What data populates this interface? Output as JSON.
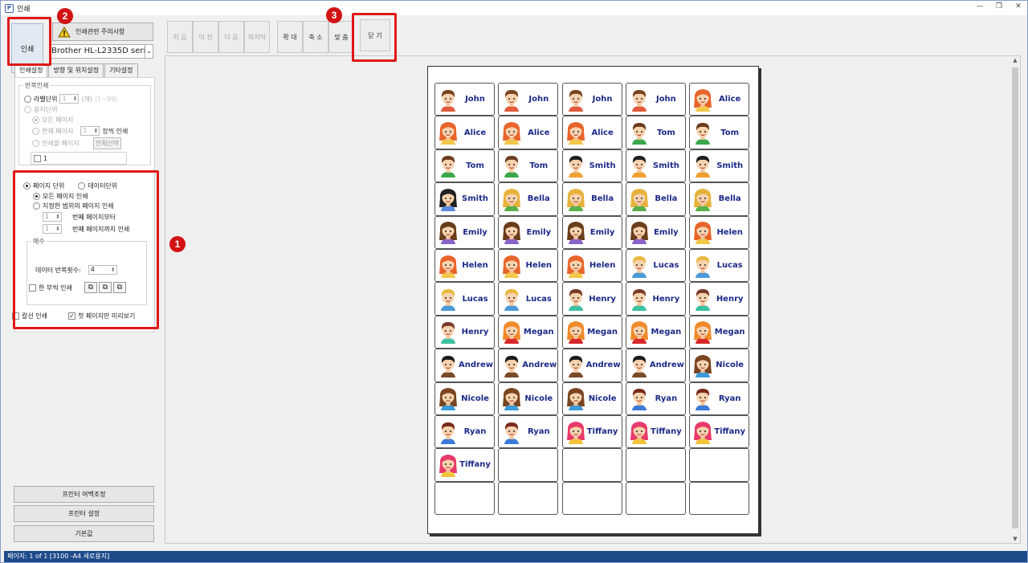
{
  "window": {
    "title": "인쇄",
    "app_icon": "print-app-icon"
  },
  "left": {
    "print_label": "인쇄",
    "notice_label": "인쇄관련 주의사항",
    "printer": "Brother HL-L2335D series(",
    "tabs": [
      "인쇄설정",
      "방향 및 위치설정",
      "기타설정"
    ],
    "repeat": {
      "title": "반복인쇄",
      "label_unit": "라벨단위",
      "label_count": "1",
      "label_count_unit": "(개)",
      "label_count_hint": "(1~99)",
      "sheet_unit": "용지단위",
      "all_pages": "모든 페이지",
      "current_page": "현재 페이지",
      "current_count": "1",
      "sheet_print": "장씩 인쇄",
      "print_pages": "인쇄할 페이지",
      "select_all": "전체선택",
      "page_item": "1"
    },
    "range": {
      "page_unit": "페이지 단위",
      "data_unit": "데이터단위",
      "all_print": "모든 페이지 인쇄",
      "range_print": "지정한 범위의 페이지 인쇄",
      "from_value": "1",
      "from_label": "번째 페이지부터",
      "to_value": "1",
      "to_label": "번째 페이지까지 인쇄"
    },
    "copies": {
      "title": "매수",
      "repeat_label": "데이터 반복횟수:",
      "repeat_value": "4",
      "one_copy": "한 부씩 인쇄"
    },
    "cutline": "칼선 인쇄",
    "first_preview": "첫 페이지만 미리보기",
    "buttons": [
      "프린터 여백조정",
      "프린터 설정",
      "기본값"
    ]
  },
  "badges": [
    "1",
    "2",
    "3"
  ],
  "toolbar": {
    "nav": [
      "처 음",
      "이 전",
      "다 음",
      "마지막"
    ],
    "zoom": [
      "확 대",
      "축 소",
      "맞 춤"
    ],
    "close": "닫 기"
  },
  "labels": [
    {
      "name": "John",
      "face": "boy-brown"
    },
    {
      "name": "John",
      "face": "boy-brown"
    },
    {
      "name": "John",
      "face": "boy-brown"
    },
    {
      "name": "John",
      "face": "boy-brown"
    },
    {
      "name": "Alice",
      "face": "girl-orange"
    },
    {
      "name": "Alice",
      "face": "girl-orange"
    },
    {
      "name": "Alice",
      "face": "girl-orange"
    },
    {
      "name": "Alice",
      "face": "girl-orange"
    },
    {
      "name": "Tom",
      "face": "boy-curly"
    },
    {
      "name": "Tom",
      "face": "boy-curly"
    },
    {
      "name": "Tom",
      "face": "boy-curly"
    },
    {
      "name": "Tom",
      "face": "boy-curly"
    },
    {
      "name": "Smith",
      "face": "boy-black"
    },
    {
      "name": "Smith",
      "face": "boy-black"
    },
    {
      "name": "Smith",
      "face": "boy-black"
    },
    {
      "name": "Smith",
      "face": "girl-black"
    },
    {
      "name": "Bella",
      "face": "girl-blonde"
    },
    {
      "name": "Bella",
      "face": "girl-blonde"
    },
    {
      "name": "Bella",
      "face": "girl-blonde"
    },
    {
      "name": "Bella",
      "face": "girl-blonde"
    },
    {
      "name": "Emily",
      "face": "girl-brown"
    },
    {
      "name": "Emily",
      "face": "girl-brown"
    },
    {
      "name": "Emily",
      "face": "girl-brown"
    },
    {
      "name": "Emily",
      "face": "girl-brown"
    },
    {
      "name": "Helen",
      "face": "girl-orange"
    },
    {
      "name": "Helen",
      "face": "girl-orange"
    },
    {
      "name": "Helen",
      "face": "girl-orange"
    },
    {
      "name": "Helen",
      "face": "girl-orange"
    },
    {
      "name": "Lucas",
      "face": "boy-blonde"
    },
    {
      "name": "Lucas",
      "face": "boy-blonde"
    },
    {
      "name": "Lucas",
      "face": "boy-blonde"
    },
    {
      "name": "Lucas",
      "face": "boy-blonde"
    },
    {
      "name": "Henry",
      "face": "boy-teal"
    },
    {
      "name": "Henry",
      "face": "boy-teal"
    },
    {
      "name": "Henry",
      "face": "boy-teal"
    },
    {
      "name": "Henry",
      "face": "boy-teal"
    },
    {
      "name": "Megan",
      "face": "girl-red"
    },
    {
      "name": "Megan",
      "face": "girl-red"
    },
    {
      "name": "Megan",
      "face": "girl-red"
    },
    {
      "name": "Megan",
      "face": "girl-red"
    },
    {
      "name": "Andrew",
      "face": "boy-dark"
    },
    {
      "name": "Andrew",
      "face": "boy-dark"
    },
    {
      "name": "Andrew",
      "face": "boy-dark"
    },
    {
      "name": "Andrew",
      "face": "boy-dark"
    },
    {
      "name": "Nicole",
      "face": "girl-headband"
    },
    {
      "name": "Nicole",
      "face": "girl-headband"
    },
    {
      "name": "Nicole",
      "face": "girl-headband"
    },
    {
      "name": "Nicole",
      "face": "girl-headband"
    },
    {
      "name": "Ryan",
      "face": "boy-red"
    },
    {
      "name": "Ryan",
      "face": "boy-red"
    },
    {
      "name": "Ryan",
      "face": "boy-red"
    },
    {
      "name": "Ryan",
      "face": "boy-red"
    },
    {
      "name": "Tiffany",
      "face": "girl-pink"
    },
    {
      "name": "Tiffany",
      "face": "girl-pink"
    },
    {
      "name": "Tiffany",
      "face": "girl-pink"
    },
    {
      "name": "Tiffany",
      "face": "girl-pink"
    },
    {
      "name": "",
      "face": ""
    },
    {
      "name": "",
      "face": ""
    },
    {
      "name": "",
      "face": ""
    },
    {
      "name": "",
      "face": ""
    },
    {
      "name": "",
      "face": ""
    },
    {
      "name": "",
      "face": ""
    },
    {
      "name": "",
      "face": ""
    },
    {
      "name": "",
      "face": ""
    },
    {
      "name": "",
      "face": ""
    }
  ],
  "face_colors": {
    "boy-brown": {
      "hair": "#7a4520",
      "shirt": "#e05a3c"
    },
    "girl-orange": {
      "hair": "#e8642a",
      "shirt": "#f3c74a"
    },
    "boy-curly": {
      "hair": "#6b3d1e",
      "shirt": "#3aa84a"
    },
    "boy-black": {
      "hair": "#1e1e1e",
      "shirt": "#f0a030"
    },
    "girl-black": {
      "hair": "#222222",
      "shirt": "#5b8de0"
    },
    "girl-blonde": {
      "hair": "#e6b23a",
      "shirt": "#5ab04a"
    },
    "girl-brown": {
      "hair": "#6a3d1c",
      "shirt": "#8a62c8"
    },
    "boy-blonde": {
      "hair": "#e8b840",
      "shirt": "#4a9ad8"
    },
    "boy-teal": {
      "hair": "#7a3a28",
      "shirt": "#3cc0a0"
    },
    "girl-red": {
      "hair": "#f08a2a",
      "shirt": "#d8282a"
    },
    "boy-dark": {
      "hair": "#1a1a1a",
      "shirt": "#7a4a28"
    },
    "girl-headband": {
      "hair": "#7a4520",
      "shirt": "#3c9ad8"
    },
    "boy-red": {
      "hair": "#7a2a1a",
      "shirt": "#3c7ad8"
    },
    "girl-pink": {
      "hair": "#e83a6a",
      "shirt": "#f3c33a"
    }
  },
  "status": "페이지: 1 of 1 [3100 -A4 세로용지]",
  "colors": {
    "highlight": "#e01818",
    "label_text": "#1b2a88",
    "status_bar": "#1e4a8a"
  }
}
